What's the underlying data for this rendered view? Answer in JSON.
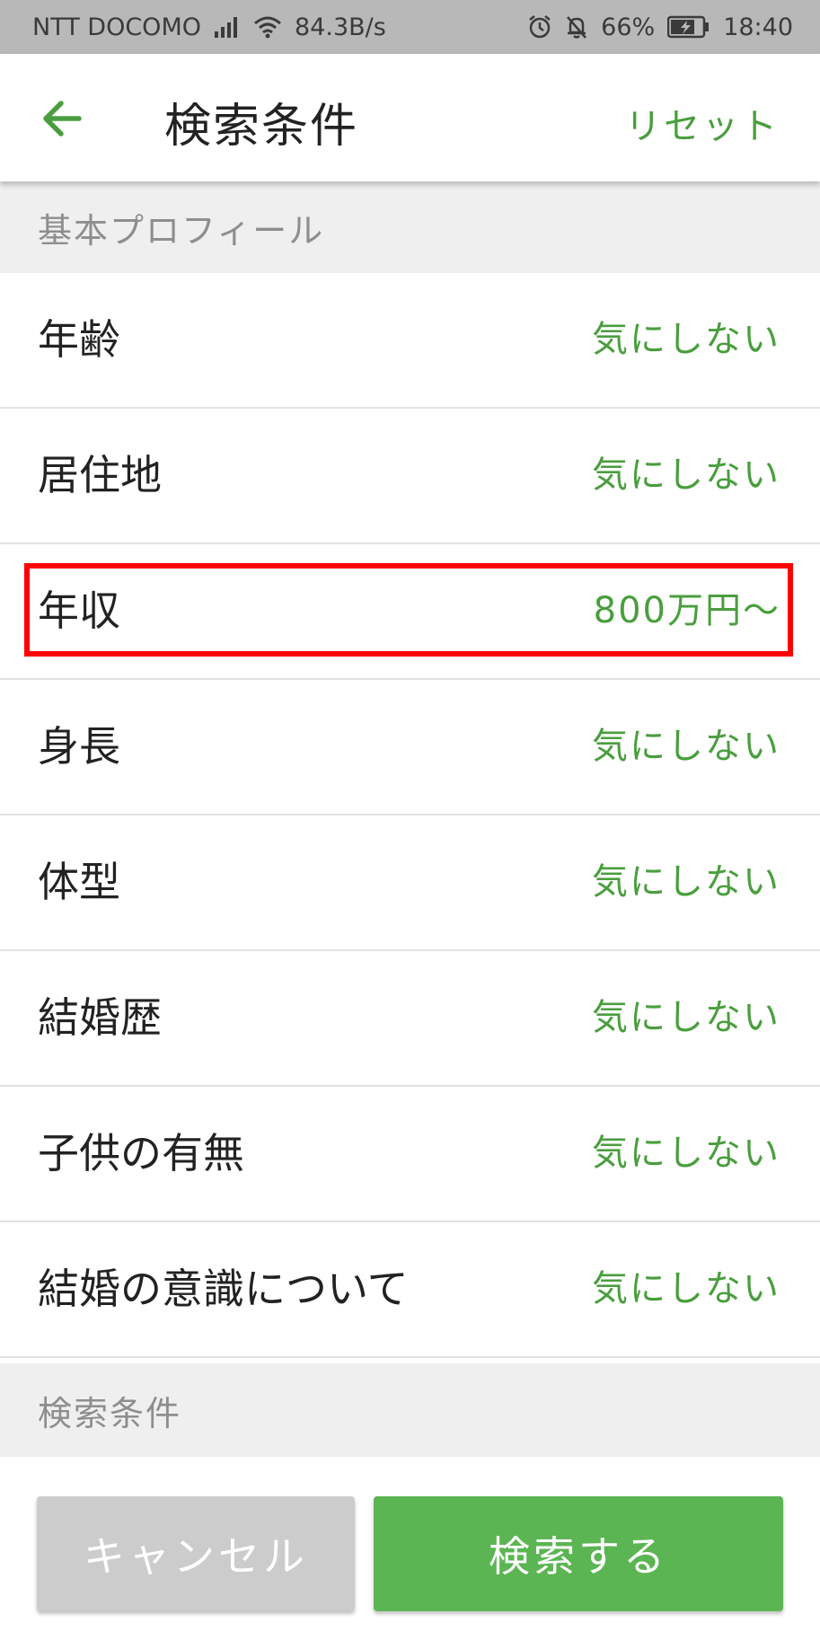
{
  "status_bar": {
    "carrier": "NTT DOCOMO",
    "net_speed": "84.3B/s",
    "battery": "66%",
    "time": "18:40"
  },
  "app_bar": {
    "title": "検索条件",
    "reset_label": "リセット"
  },
  "sections": {
    "basic_profile": "基本プロフィール",
    "search_conditions": "検索条件"
  },
  "rows": [
    {
      "label": "年齢",
      "value": "気にしない"
    },
    {
      "label": "居住地",
      "value": "気にしない"
    },
    {
      "label": "年収",
      "value": "800万円〜"
    },
    {
      "label": "身長",
      "value": "気にしない"
    },
    {
      "label": "体型",
      "value": "気にしない"
    },
    {
      "label": "結婚歴",
      "value": "気にしない"
    },
    {
      "label": "子供の有無",
      "value": "気にしない"
    },
    {
      "label": "結婚の意識について",
      "value": "気にしない"
    }
  ],
  "buttons": {
    "cancel": "キャンセル",
    "search": "検索する"
  },
  "colors": {
    "accent_green": "#4a9e3e",
    "button_green": "#5cb553",
    "highlight_red": "#ff0000"
  }
}
